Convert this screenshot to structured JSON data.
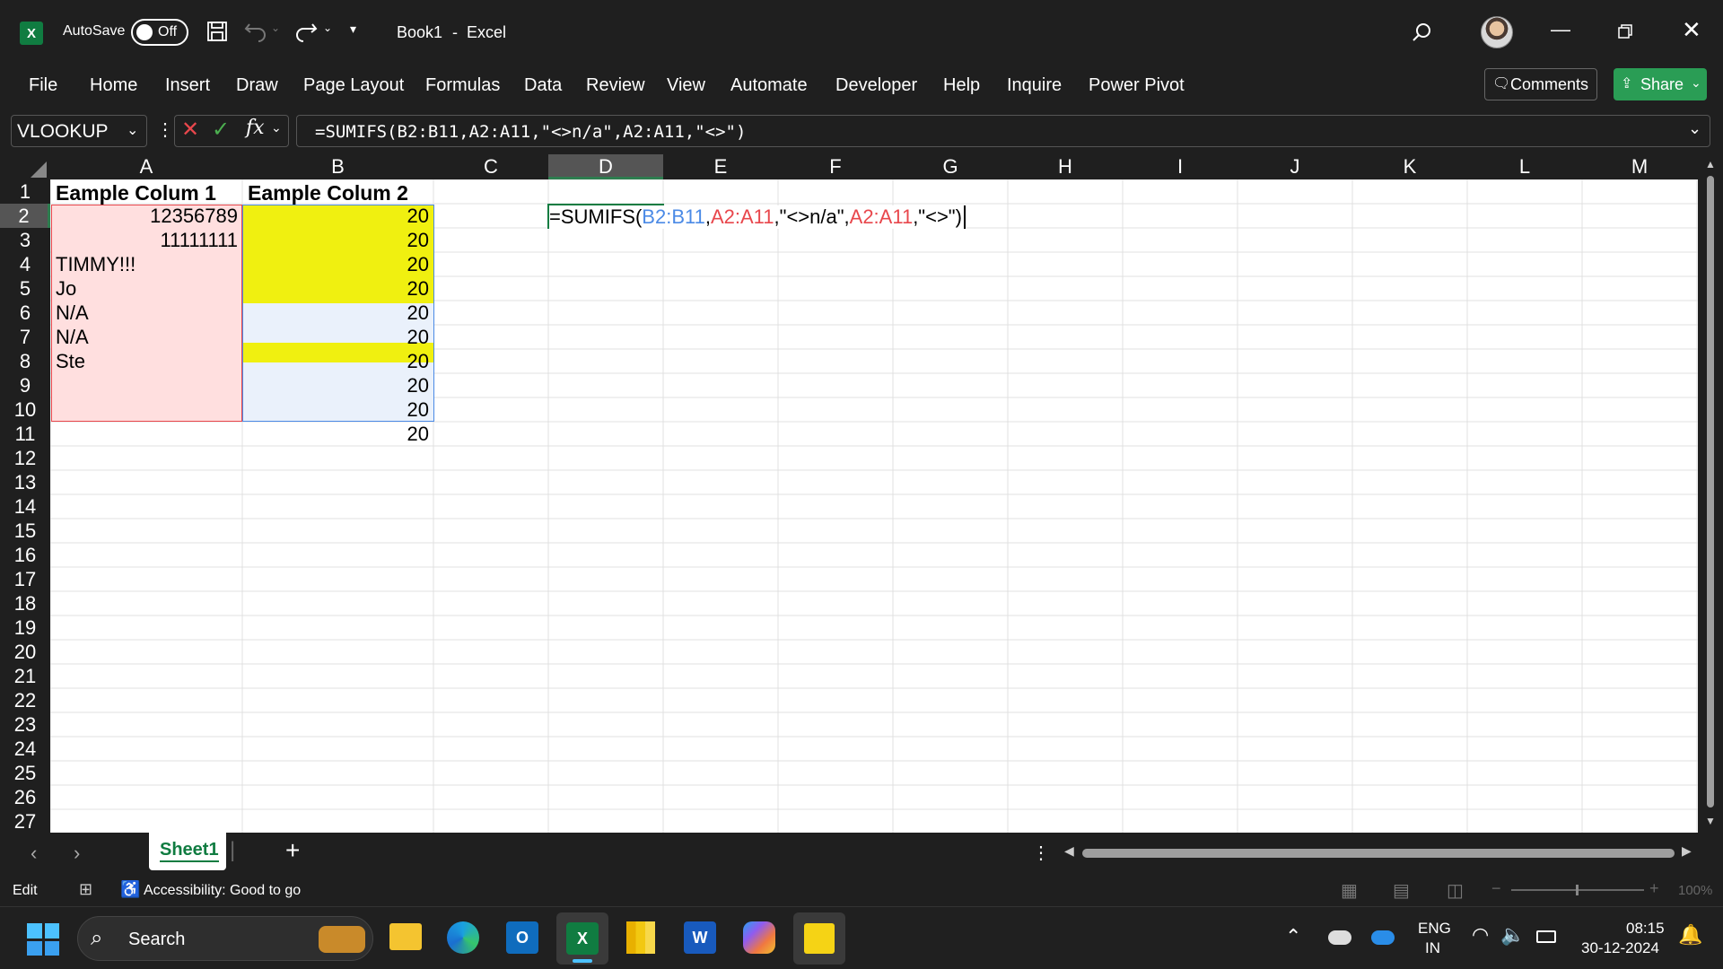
{
  "titlebar": {
    "autosave_label": "AutoSave",
    "autosave_state": "Off",
    "doc_title": "Book1",
    "sep": "-",
    "app_name": "Excel"
  },
  "menu": [
    "File",
    "Home",
    "Insert",
    "Draw",
    "Page Layout",
    "Formulas",
    "Data",
    "Review",
    "View",
    "Automate",
    "Developer",
    "Help",
    "Inquire",
    "Power Pivot"
  ],
  "comments_label": "Comments",
  "share_label": "Share",
  "formula_bar": {
    "name_box": "VLOOKUP",
    "fx": "fx",
    "formula": "=SUMIFS(B2:B11,A2:A11,\"<>n/a\",A2:A11,\"<>\")"
  },
  "columns": [
    "A",
    "B",
    "C",
    "D",
    "E",
    "F",
    "G",
    "H",
    "I",
    "J",
    "K",
    "L",
    "M"
  ],
  "rows": [
    "1",
    "2",
    "3",
    "4",
    "5",
    "6",
    "7",
    "8",
    "9",
    "10",
    "11",
    "12",
    "13",
    "14",
    "15",
    "16",
    "17",
    "18",
    "19",
    "20",
    "21",
    "22",
    "23",
    "24",
    "25",
    "26",
    "27"
  ],
  "cells": {
    "a1": "Eample Colum 1",
    "b1": "Eample Colum 2",
    "a2": "12356789",
    "a3": "11111111",
    "a4": "TIMMY!!!",
    "a5": "Jo",
    "a6": "N/A",
    "a7": "N/A",
    "a8": "Ste",
    "b_values": [
      "20",
      "20",
      "20",
      "20",
      "20",
      "20",
      "20",
      "20",
      "20",
      "20"
    ]
  },
  "edit_formula": {
    "p1": "=SUMIFS(",
    "p2": "B2:B11",
    "p3": ",",
    "p4": "A2:A11",
    "p5": ",\"<>n/a\",",
    "p6": "A2:A11",
    "p7": ",\"<>\")"
  },
  "sheet_tab": "Sheet1",
  "status": {
    "mode": "Edit",
    "accessibility": "Accessibility: Good to go",
    "zoom": "100%"
  },
  "taskbar": {
    "search": "Search",
    "lang1": "ENG",
    "lang2": "IN",
    "time": "08:15",
    "date": "30-12-2024"
  },
  "colors": {
    "excel_green": "#107c41",
    "pink_fill": "#ffdfdf",
    "yellow_fill": "#f0f010",
    "blue_fill": "#eaf1fb",
    "ref_blue": "#4b8ae6",
    "ref_red": "#e8474c"
  }
}
